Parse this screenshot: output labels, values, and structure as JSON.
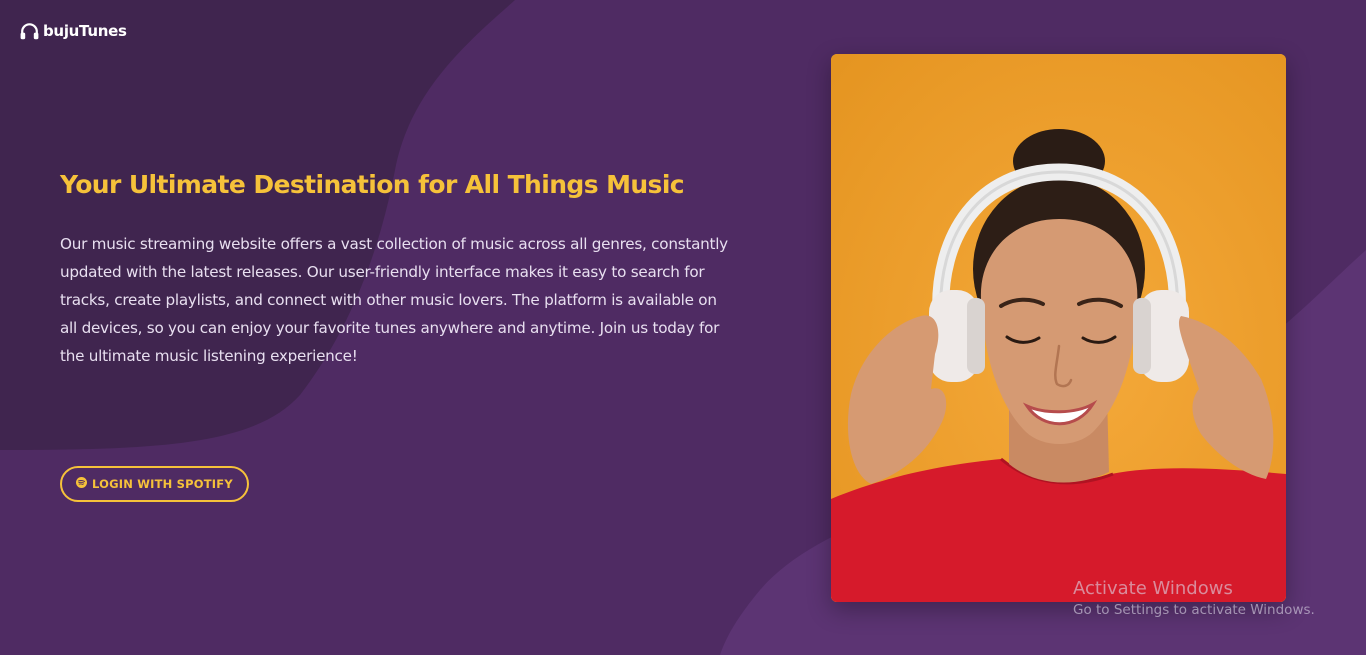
{
  "brand": {
    "name": "bujuTunes",
    "icon": "headphones-icon"
  },
  "hero": {
    "title": "Your Ultimate Destination for All Things Music",
    "description": "Our music streaming website offers a vast collection of music across all genres, constantly updated with the latest releases. Our user-friendly interface makes it easy to search for tracks, create playlists, and connect with other music lovers. The platform is available on all devices, so you can enjoy your favorite tunes anywhere and anytime. Join us today for the ultimate music listening experience!",
    "cta_label": "LOGIN WITH SPOTIFY",
    "cta_icon": "spotify-icon"
  },
  "watermark": {
    "title": "Activate Windows",
    "subtitle": "Go to Settings to activate Windows."
  },
  "colors": {
    "background": "#4f2b63",
    "background_dark": "#40254f",
    "background_light": "#5c3473",
    "accent": "#f6c23a",
    "text": "#e8dff0",
    "photo_backdrop": "#e99c25",
    "shirt": "#d61a2b"
  }
}
